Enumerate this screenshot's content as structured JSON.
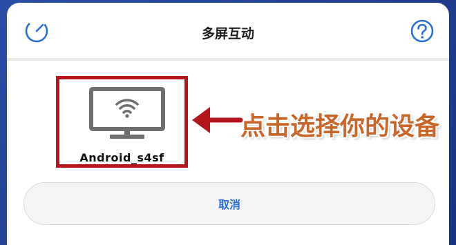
{
  "dialog": {
    "title": "多屏互动"
  },
  "header": {
    "left_icon": "refresh-icon",
    "right_icon": "help-icon"
  },
  "devices": [
    {
      "name": "Android_s4sf",
      "icon": "tv-wifi-icon"
    }
  ],
  "annotation": {
    "hint_text": "点击选择你的设备"
  },
  "actions": {
    "cancel_label": "取消"
  },
  "colors": {
    "accent_blue": "#2a6fd6",
    "highlight_red": "#b5161c",
    "hint_orange": "#c9672b"
  }
}
